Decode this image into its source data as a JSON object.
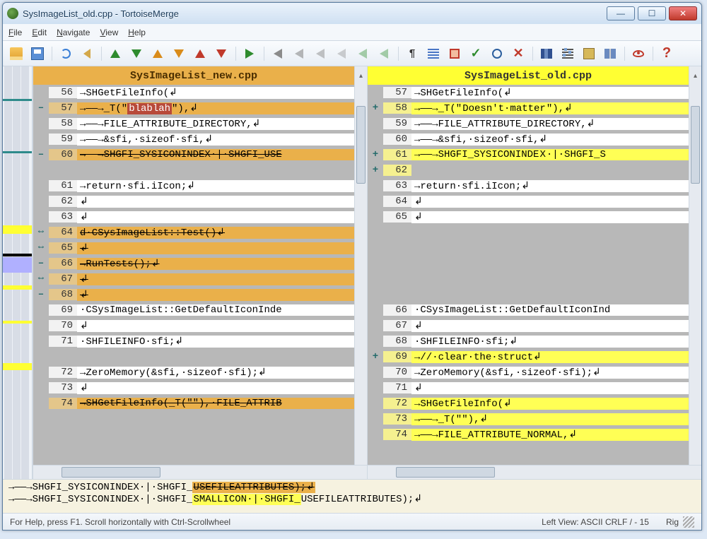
{
  "window": {
    "title": "SysImageList_old.cpp - TortoiseMerge"
  },
  "menu": {
    "file": "File",
    "edit": "Edit",
    "navigate": "Navigate",
    "view": "View",
    "help": "Help"
  },
  "panes": {
    "left_title": "SysImageList_new.cpp",
    "right_title": "SysImageList_old.cpp"
  },
  "left_lines": [
    {
      "n": "56",
      "cls": "normal",
      "mark": "",
      "text": "→SHGetFileInfo(↲"
    },
    {
      "n": "57",
      "cls": "orange",
      "mark": "–",
      "pre": "→——→_T(\"",
      "red": "blablah",
      "post": "\"),↲"
    },
    {
      "n": "58",
      "cls": "normal",
      "mark": "",
      "text": "→——→FILE_ATTRIBUTE_DIRECTORY,↲"
    },
    {
      "n": "59",
      "cls": "normal",
      "mark": "",
      "text": "→——→&sfi,·sizeof·sfi,↲"
    },
    {
      "n": "60",
      "cls": "orange",
      "mark": "–",
      "text": "→——→SHGFI_SYSICONINDEX·|·SHGFI_USE",
      "strike": true
    },
    {
      "n": "",
      "cls": "gray",
      "mark": "",
      "text": ""
    },
    {
      "n": "61",
      "cls": "normal",
      "mark": "",
      "text": "→return·sfi.iIcon;↲"
    },
    {
      "n": "62",
      "cls": "normal",
      "mark": "",
      "text": "↲"
    },
    {
      "n": "63",
      "cls": "normal",
      "mark": "",
      "text": "↲"
    },
    {
      "n": "64",
      "cls": "orange",
      "mark": "⇔",
      "text": "d·CSysImageList::Test()↲",
      "strike": true
    },
    {
      "n": "65",
      "cls": "orange",
      "mark": "⇔",
      "text": "↲",
      "strike": true
    },
    {
      "n": "66",
      "cls": "orange",
      "mark": "–",
      "text": "→RunTests();↲",
      "strike": true
    },
    {
      "n": "67",
      "cls": "orange",
      "mark": "⇔",
      "text": "↲",
      "strike": true
    },
    {
      "n": "68",
      "cls": "orange",
      "mark": "–",
      "text": "↲",
      "strike": true
    },
    {
      "n": "69",
      "cls": "normal",
      "mark": "",
      "text": "·CSysImageList::GetDefaultIconInde"
    },
    {
      "n": "70",
      "cls": "normal",
      "mark": "",
      "text": "↲"
    },
    {
      "n": "71",
      "cls": "normal",
      "mark": "",
      "text": "·SHFILEINFO·sfi;↲"
    },
    {
      "n": "",
      "cls": "gray",
      "mark": "",
      "text": ""
    },
    {
      "n": "72",
      "cls": "normal",
      "mark": "",
      "text": "→ZeroMemory(&sfi,·sizeof·sfi);↲"
    },
    {
      "n": "73",
      "cls": "normal",
      "mark": "",
      "text": "↲"
    },
    {
      "n": "74",
      "cls": "orange",
      "mark": "",
      "text": "→SHGetFileInfo(_T(\"\"),·FILE_ATTRIB",
      "strike": true
    }
  ],
  "right_lines": [
    {
      "n": "57",
      "cls": "normal",
      "mark": "",
      "text": "→SHGetFileInfo(↲"
    },
    {
      "n": "58",
      "cls": "yellow",
      "mark": "+",
      "pre": "→——→_T(\"",
      "yel": "Doesn't·matter",
      "post": "\"),↲"
    },
    {
      "n": "59",
      "cls": "normal",
      "mark": "",
      "text": "→——→FILE_ATTRIBUTE_DIRECTORY,↲"
    },
    {
      "n": "60",
      "cls": "normal",
      "mark": "",
      "text": "→——→&sfi,·sizeof·sfi,↲"
    },
    {
      "n": "61",
      "cls": "yellow",
      "mark": "+",
      "pre": "→——→SHGFI_SYSICONINDE",
      "yel": "X",
      "post": "·|·SHGFI_S"
    },
    {
      "n": "62",
      "cls": "yellow",
      "mark": "+",
      "text": ""
    },
    {
      "n": "63",
      "cls": "normal",
      "mark": "",
      "text": "→return·sfi.iIcon;↲"
    },
    {
      "n": "64",
      "cls": "normal",
      "mark": "",
      "text": "↲"
    },
    {
      "n": "65",
      "cls": "normal",
      "mark": "",
      "text": "↲"
    },
    {
      "n": "",
      "cls": "gray",
      "mark": "",
      "text": ""
    },
    {
      "n": "",
      "cls": "gray",
      "mark": "",
      "text": ""
    },
    {
      "n": "",
      "cls": "gray",
      "mark": "",
      "text": ""
    },
    {
      "n": "",
      "cls": "gray",
      "mark": "",
      "text": ""
    },
    {
      "n": "",
      "cls": "gray",
      "mark": "",
      "text": ""
    },
    {
      "n": "66",
      "cls": "normal",
      "mark": "",
      "text": "·CSysImageList::GetDefaultIconInd"
    },
    {
      "n": "67",
      "cls": "normal",
      "mark": "",
      "text": "↲"
    },
    {
      "n": "68",
      "cls": "normal",
      "mark": "",
      "text": "·SHFILEINFO·sfi;↲"
    },
    {
      "n": "69",
      "cls": "yellow",
      "mark": "+",
      "text": "→//·clear·the·struct↲"
    },
    {
      "n": "70",
      "cls": "normal",
      "mark": "",
      "text": "→ZeroMemory(&sfi,·sizeof·sfi);↲"
    },
    {
      "n": "71",
      "cls": "normal",
      "mark": "",
      "text": "↲"
    },
    {
      "n": "72",
      "cls": "yellow",
      "mark": "",
      "text": "→SHGetFileInfo(↲"
    },
    {
      "n": "73",
      "cls": "yellow",
      "mark": "",
      "text": "→——→_T(\"\"),↲"
    },
    {
      "n": "74",
      "cls": "yellow",
      "mark": "",
      "text": "→——→FILE_ATTRIBUTE_NORMAL,↲"
    }
  ],
  "bottom": {
    "line1_pre": "→——→SHGFI_SYSICONINDEX·|·SHGFI_",
    "line1_strike": "USEFILEATTRIBUTES);↲",
    "line2_pre": "→——→SHGFI_SYSICONINDEX·|·SHGFI_",
    "line2_yel": "SMALLICON·|·SHGFI_",
    "line2_post": "USEFILEATTRIBUTES);↲"
  },
  "status": {
    "help": "For Help, press F1. Scroll horizontally with Ctrl-Scrollwheel",
    "right": "Left View: ASCII CRLF  / - 15",
    "rig": "Rig"
  }
}
